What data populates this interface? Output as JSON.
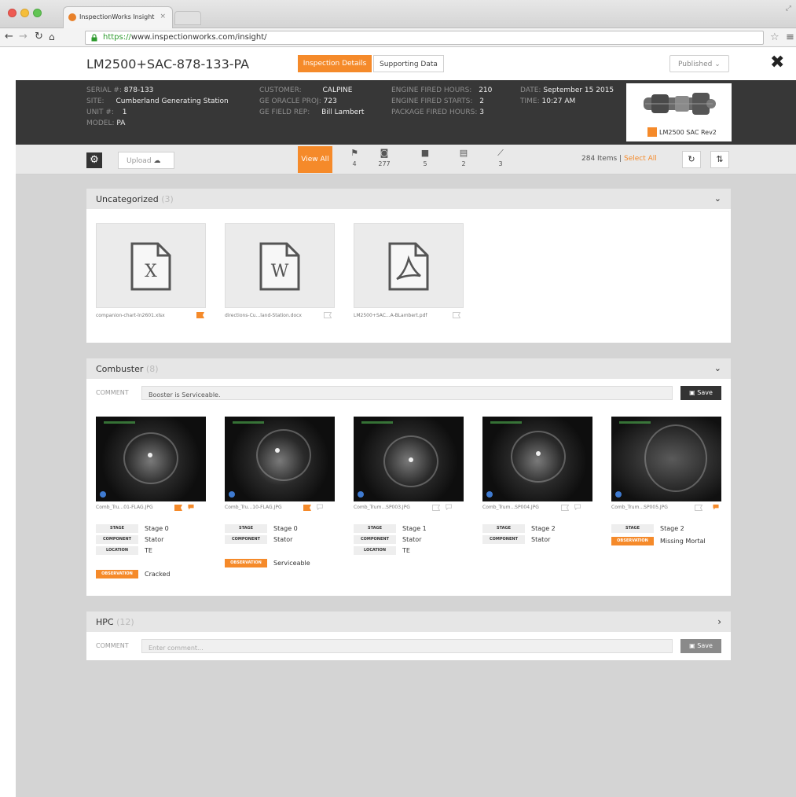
{
  "browser": {
    "tab_title": "InspectionWorks Insight",
    "url_scheme": "https://",
    "url_rest": "www.inspectionworks.com/insight/"
  },
  "header": {
    "asset_title": "LM2500+SAC-878-133-PA",
    "tabs": [
      "Inspection Details",
      "Supporting Data"
    ],
    "status": "Published"
  },
  "info": {
    "serial_label": "SERIAL #:",
    "serial": "878-133",
    "site_label": "SITE:",
    "site": "Cumberland Generating Station",
    "unit_label": "UNIT #:",
    "unit": "1",
    "model_label": "MODEL:",
    "model": "PA",
    "customer_label": "CUSTOMER:",
    "customer": "CALPINE",
    "oracle_label": "GE ORACLE PROJ:",
    "oracle": "723",
    "field_rep_label": "GE FIELD REP:",
    "field_rep": "Bill Lambert",
    "fired_hours_label": "ENGINE FIRED HOURS:",
    "fired_hours": "210",
    "fired_starts_label": "ENGINE FIRED STARTS:",
    "fired_starts": "2",
    "package_hours_label": "PACKAGE FIRED HOURS:",
    "package_hours": "3",
    "date_label": "DATE:",
    "date": "September 15 2015",
    "time_label": "TIME:",
    "time": "10:27 AM",
    "engine_model": "LM2500 SAC Rev2"
  },
  "toolbar": {
    "upload_label": "Upload",
    "view_all": "View All",
    "filters": [
      {
        "icon": "flag-icon",
        "glyph": "⚑",
        "count": "4"
      },
      {
        "icon": "camera-icon",
        "glyph": "◙",
        "count": "277"
      },
      {
        "icon": "video-icon",
        "glyph": "■",
        "count": "5"
      },
      {
        "icon": "document-icon",
        "glyph": "▤",
        "count": "2"
      },
      {
        "icon": "chart-icon",
        "glyph": "⟋",
        "count": "3"
      }
    ],
    "items_count": "284 Items",
    "separator": "|",
    "select_all": "Select All"
  },
  "uncategorized": {
    "title": "Uncategorized",
    "count": "(3)",
    "docs": [
      {
        "letter": "X",
        "name": "companion-chart-ln2601.xlsx"
      },
      {
        "letter": "W",
        "name": "directions-Cu...land-Station.docx"
      },
      {
        "letter": "",
        "name": "LM2500+SAC...A-BLambert.pdf"
      }
    ]
  },
  "combuster": {
    "title": "Combuster",
    "count": "(8)",
    "comment_label": "COMMENT",
    "comment_value": "Booster is Serviceable.",
    "save_label": "Save",
    "stage_label": "STAGE",
    "component_label": "COMPONENT",
    "location_label": "LOCATION",
    "observation_label": "OBSERVATION",
    "images": [
      {
        "name": "Comb_Tru...01-FLAG.JPG",
        "stage": "Stage 0",
        "component": "Stator",
        "location": "TE",
        "observation": "Cracked"
      },
      {
        "name": "Comb_Tru...10-FLAG.JPG",
        "stage": "Stage 0",
        "component": "Stator",
        "observation": "Serviceable"
      },
      {
        "name": "Comb_Trum...SP003.JPG",
        "stage": "Stage 1",
        "component": "Stator",
        "location": "TE"
      },
      {
        "name": "Comb_Trum...SP004.JPG",
        "stage": "Stage 2",
        "component": "Stator"
      },
      {
        "name": "Comb_Trum...SP005.JPG",
        "stage": "Stage 2",
        "observation": "Missing Mortal"
      }
    ]
  },
  "hpc": {
    "title": "HPC",
    "count": "(12)",
    "comment_label": "COMMENT",
    "comment_placeholder": "Enter comment...",
    "save_label": "Save"
  },
  "colors": {
    "accent": "#f58a2a",
    "info_bar": "#373737",
    "page_bg": "#d4d4d4"
  }
}
